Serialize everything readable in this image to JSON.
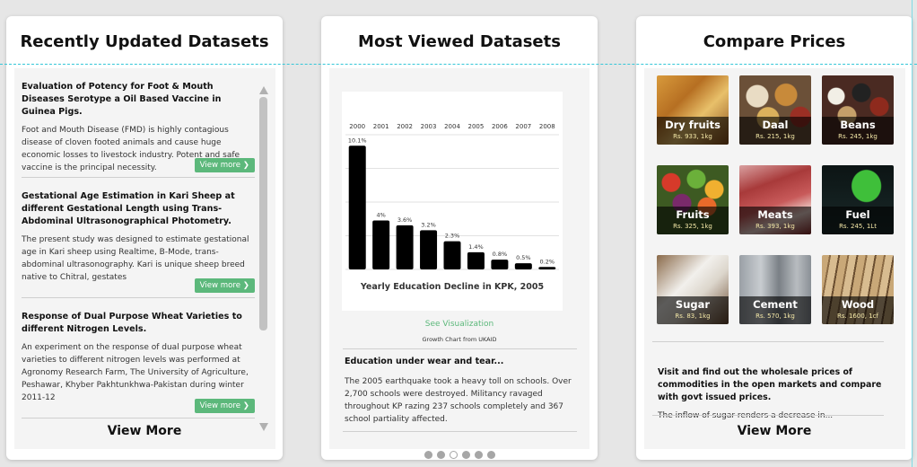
{
  "recent": {
    "title": "Recently Updated Datasets",
    "view_more": "View More",
    "items": [
      {
        "title": "Evaluation of Potency for Foot & Mouth Diseases Serotype a Oil Based Vaccine in Guinea Pigs.",
        "desc": "Foot and Mouth Disease (FMD) is highly contagious disease of cloven footed animals and cause huge economic losses to livestock industry. Potent and safe vaccine is the principal necessity.",
        "button": "View more ❯"
      },
      {
        "title": "Gestational Age Estimation in Kari Sheep at different Gestational Length using Trans-Abdominal Ultrasonographical Photometry.",
        "desc": "The present study was designed to estimate gestational age in Kari sheep using Realtime, B-Mode, trans-abdominal ultrasonography. Kari is unique sheep breed native to Chitral, gestates",
        "button": "View more ❯"
      },
      {
        "title": "Response of Dual Purpose Wheat Varieties to different Nitrogen Levels.",
        "desc": "An experiment on the response of dual purpose wheat varieties to different nitrogen levels was performed at Agronomy Research Farm, The University of Agriculture, Peshawar, Khyber Pakhtunkhwa-Pakistan during winter 2011-12",
        "button": "View more ❯"
      }
    ]
  },
  "most_viewed": {
    "title": "Most Viewed Datasets",
    "see_visualization": "See Visualization",
    "chart_source": "Growth Chart from UKAID",
    "story_title": "Education under wear and tear...",
    "story_text": "The 2005 earthquake took a heavy toll on schools. Over 2,700 schools were destroyed. Militancy ravaged throughout KP razing 237 schools completely and 367 school partiality affected.",
    "carousel_count": 6,
    "carousel_active": 2
  },
  "chart_data": {
    "type": "bar",
    "title": "Yearly Education Decline in KPK, 2005",
    "categories": [
      "2000",
      "2001",
      "2002",
      "2003",
      "2004",
      "2005",
      "2006",
      "2007",
      "2008"
    ],
    "values": [
      10.1,
      4,
      3.6,
      3.2,
      2.3,
      1.4,
      0.8,
      0.5,
      0.2
    ],
    "labels": [
      "10.1%",
      "4%",
      "3.6%",
      "3.2%",
      "2.3%",
      "1.4%",
      "0.8%",
      "0.5%",
      "0.2%"
    ],
    "ylim": [
      0,
      11
    ],
    "bar_color": "#000000",
    "grid": true
  },
  "compare": {
    "title": "Compare Prices",
    "view_more": "View More",
    "text": "Visit and find out the wholesale prices of commodities in the open markets and compare with govt issued prices.",
    "sub": "The inflow of sugar renders a decrease in...",
    "items": [
      {
        "name": "Dry fruits",
        "price": "Rs. 933, 1kg"
      },
      {
        "name": "Daal",
        "price": "Rs. 215, 1kg"
      },
      {
        "name": "Beans",
        "price": "Rs. 245, 1kg"
      },
      {
        "name": "Fruits",
        "price": "Rs. 325, 1kg"
      },
      {
        "name": "Meats",
        "price": "Rs. 393, 1kg"
      },
      {
        "name": "Fuel",
        "price": "Rs. 245, 1Lt"
      },
      {
        "name": "Sugar",
        "price": "Rs. 83, 1kg"
      },
      {
        "name": "Cement",
        "price": "Rs. 570, 1kg"
      },
      {
        "name": "Wood",
        "price": "Rs. 1600, 1cf"
      }
    ]
  },
  "colors": {
    "accent_green": "#5cb87b",
    "guide_cyan": "#35c7d8"
  }
}
